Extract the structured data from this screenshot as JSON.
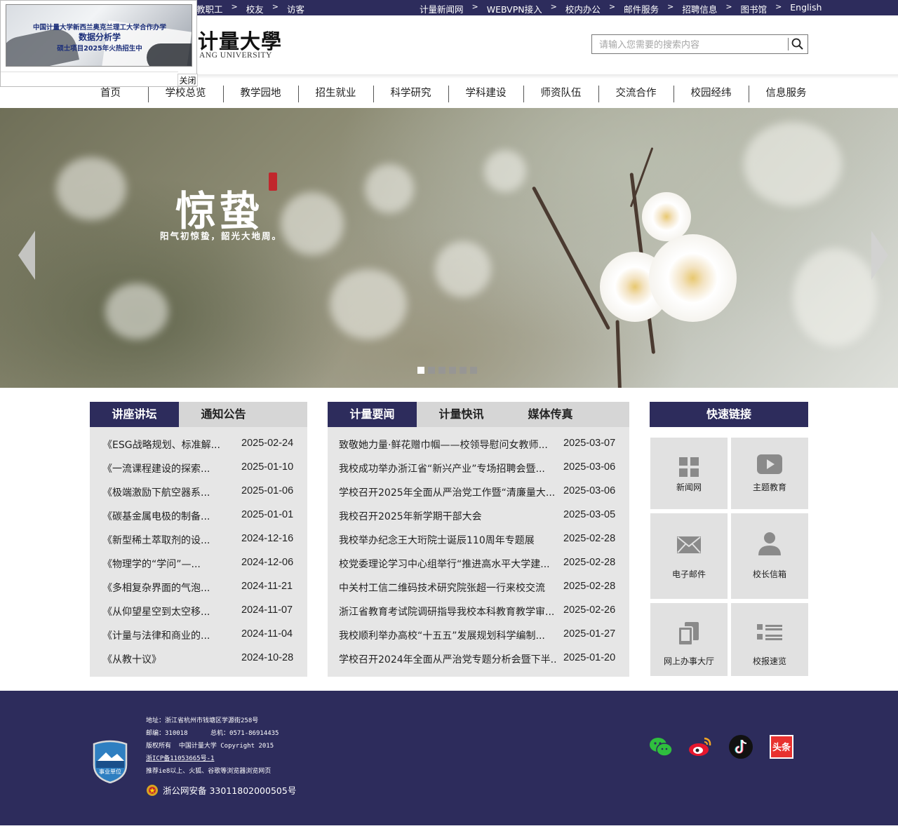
{
  "topbar": {
    "left_links": [
      "教职工",
      "校友",
      "访客"
    ],
    "right_links": [
      "计量新闻网",
      "WEBVPN接入",
      "校内办公",
      "邮件服务",
      "招聘信息",
      "图书馆",
      "English"
    ],
    "separator": ">"
  },
  "header": {
    "logo_cn": "计量大學",
    "logo_en": "ANG UNIVERSITY",
    "search_placeholder": "请输入您需要的搜索内容",
    "search_icon": "search-icon"
  },
  "nav": [
    "首页",
    "学校总览",
    "教学园地",
    "招生就业",
    "科学研究",
    "学科建设",
    "师资队伍",
    "交流合作",
    "校园经纬",
    "信息服务"
  ],
  "popup": {
    "line1": "中国计量大学新西兰奥克兰理工大学合作办学",
    "line2": "数据分析学",
    "line3": "硕士项目2025年火热招生中",
    "close_label": "关闭"
  },
  "banner": {
    "title": "惊蛰",
    "subtitle": "阳气初惊蛰，韶光大地周。",
    "slide_count": 6,
    "active_slide": 1
  },
  "lectures": {
    "tabs": [
      "讲座讲坛",
      "通知公告"
    ],
    "active_tab": 0,
    "items": [
      {
        "title": "《ESG战略规划、标准解...",
        "date": "2025-02-24"
      },
      {
        "title": "《一流课程建设的探索...",
        "date": "2025-01-10"
      },
      {
        "title": "《极端激励下航空器系...",
        "date": "2025-01-06"
      },
      {
        "title": "《碳基金属电极的制备...",
        "date": "2025-01-01"
      },
      {
        "title": "《新型稀土萃取剂的设...",
        "date": "2024-12-16"
      },
      {
        "title": "《物理学的“学问”—...",
        "date": "2024-12-06"
      },
      {
        "title": "《多相复杂界面的气泡...",
        "date": "2024-11-21"
      },
      {
        "title": "《从仰望星空到太空移...",
        "date": "2024-11-07"
      },
      {
        "title": "《计量与法律和商业的...",
        "date": "2024-11-04"
      },
      {
        "title": "《从教十议》",
        "date": "2024-10-28"
      }
    ]
  },
  "news": {
    "tabs": [
      "计量要闻",
      "计量快讯",
      "媒体传真"
    ],
    "active_tab": 0,
    "items": [
      {
        "title": "致敬她力量·鲜花赠巾帼——校领导慰问女教师...",
        "date": "2025-03-07"
      },
      {
        "title": "我校成功举办浙江省“新兴产业”专场招聘会暨...",
        "date": "2025-03-06"
      },
      {
        "title": "学校召开2025年全面从严治党工作暨“清廉量大...",
        "date": "2025-03-06"
      },
      {
        "title": "我校召开2025年新学期干部大会",
        "date": "2025-03-05"
      },
      {
        "title": "我校举办纪念王大珩院士诞辰110周年专题展",
        "date": "2025-02-28"
      },
      {
        "title": "校党委理论学习中心组举行“推进高水平大学建...",
        "date": "2025-02-28"
      },
      {
        "title": "中关村工信二维码技术研究院张超一行来校交流",
        "date": "2025-02-28"
      },
      {
        "title": "浙江省教育考试院调研指导我校本科教育教学审...",
        "date": "2025-02-26"
      },
      {
        "title": "我校顺利举办高校“十五五”发展规划科学编制...",
        "date": "2025-01-27"
      },
      {
        "title": "学校召开2024年全面从严治党专题分析会暨下半...",
        "date": "2025-01-20"
      }
    ]
  },
  "quick": {
    "title": "快速链接",
    "items": [
      {
        "label": "新闻网",
        "icon": "grid-icon"
      },
      {
        "label": "主题教育",
        "icon": "play-icon"
      },
      {
        "label": "电子邮件",
        "icon": "mail-icon"
      },
      {
        "label": "校长信箱",
        "icon": "user-icon"
      },
      {
        "label": "网上办事大厅",
        "icon": "devices-icon"
      },
      {
        "label": "校报速览",
        "icon": "list-icon"
      }
    ]
  },
  "footer": {
    "address": "地址：浙江省杭州市钱塘区学源街258号",
    "postcode_phone": "邮编：310018      总机：0571-86914435",
    "copyright": "版权所有  中国计量大学 Copyright 2015",
    "icp": "浙ICP备11053665号-1",
    "browser": "推荐ie8以上、火狐、谷歌等浏览器浏览网页",
    "police": "浙公网安备 33011802000505号",
    "badge_text": "事业单位",
    "social": [
      "wechat-icon",
      "weibo-icon",
      "tiktok-icon",
      "toutiao-icon"
    ],
    "toutiao_label": "头条"
  },
  "colors": {
    "brand": "#2d2c5c",
    "panel_bg": "#e6e6e6",
    "tab_bg": "#d6d6d6"
  }
}
